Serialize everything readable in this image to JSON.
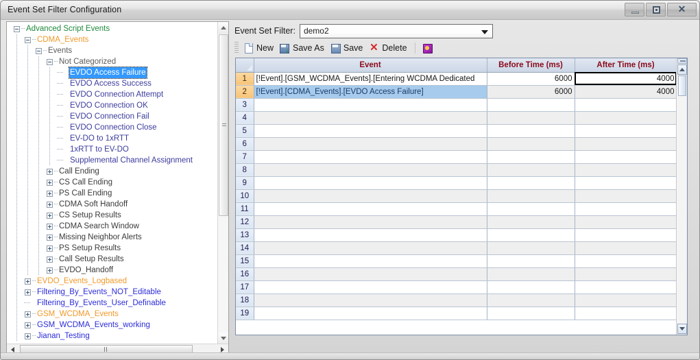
{
  "window": {
    "title": "Event Set Filter Configuration",
    "controls": {
      "minimize": "–",
      "restore": "❐",
      "close": "✕"
    }
  },
  "tree": {
    "nodes": [
      {
        "label": "Advanced Script Events",
        "depth": 0,
        "color": "green",
        "state": "expanded",
        "selected": false
      },
      {
        "label": "CDMA_Events",
        "depth": 1,
        "color": "orange",
        "state": "expanded",
        "selected": false
      },
      {
        "label": "Events",
        "depth": 2,
        "color": "gray",
        "state": "expanded",
        "selected": false
      },
      {
        "label": "Not Categorized",
        "depth": 3,
        "color": "gray",
        "state": "expanded",
        "selected": false
      },
      {
        "label": "EVDO Access Failure",
        "depth": 4,
        "color": "navy",
        "state": "leaf",
        "selected": true
      },
      {
        "label": "EVDO Access Success",
        "depth": 4,
        "color": "navy",
        "state": "leaf",
        "selected": false
      },
      {
        "label": "EVDO Connection Attempt",
        "depth": 4,
        "color": "navy",
        "state": "leaf",
        "selected": false
      },
      {
        "label": "EVDO Connection OK",
        "depth": 4,
        "color": "navy",
        "state": "leaf",
        "selected": false
      },
      {
        "label": "EVDO Connection Fail",
        "depth": 4,
        "color": "navy",
        "state": "leaf",
        "selected": false
      },
      {
        "label": "EVDO Connection Close",
        "depth": 4,
        "color": "navy",
        "state": "leaf",
        "selected": false
      },
      {
        "label": "EV-DO to 1xRTT",
        "depth": 4,
        "color": "navy",
        "state": "leaf",
        "selected": false
      },
      {
        "label": "1xRTT to EV-DO",
        "depth": 4,
        "color": "navy",
        "state": "leaf",
        "selected": false
      },
      {
        "label": "Supplemental Channel Assignment",
        "depth": 4,
        "color": "navy",
        "state": "leaf",
        "selected": false
      },
      {
        "label": "Call Ending",
        "depth": 3,
        "color": "dark",
        "state": "collapsed",
        "selected": false
      },
      {
        "label": "CS Call Ending",
        "depth": 3,
        "color": "dark",
        "state": "collapsed",
        "selected": false
      },
      {
        "label": "PS Call Ending",
        "depth": 3,
        "color": "dark",
        "state": "collapsed",
        "selected": false
      },
      {
        "label": "CDMA Soft Handoff",
        "depth": 3,
        "color": "dark",
        "state": "collapsed",
        "selected": false
      },
      {
        "label": "CS Setup Results",
        "depth": 3,
        "color": "dark",
        "state": "collapsed",
        "selected": false
      },
      {
        "label": "CDMA Search Window",
        "depth": 3,
        "color": "dark",
        "state": "collapsed",
        "selected": false
      },
      {
        "label": "Missing Neighbor Alerts",
        "depth": 3,
        "color": "dark",
        "state": "collapsed",
        "selected": false
      },
      {
        "label": "PS Setup Results",
        "depth": 3,
        "color": "dark",
        "state": "collapsed",
        "selected": false
      },
      {
        "label": "Call Setup Results",
        "depth": 3,
        "color": "dark",
        "state": "collapsed",
        "selected": false
      },
      {
        "label": "EVDO_Handoff",
        "depth": 3,
        "color": "dark",
        "state": "collapsed",
        "selected": false
      },
      {
        "label": "EVDO_Events_Logbased",
        "depth": 1,
        "color": "orange",
        "state": "collapsed",
        "selected": false
      },
      {
        "label": "Filtering_By_Events_NOT_Editable",
        "depth": 1,
        "color": "blue",
        "state": "collapsed",
        "selected": false
      },
      {
        "label": "Filtering_By_Events_User_Definable",
        "depth": 1,
        "color": "blue",
        "state": "leaf",
        "selected": false
      },
      {
        "label": "GSM_WCDMA_Events",
        "depth": 1,
        "color": "orange",
        "state": "collapsed",
        "selected": false
      },
      {
        "label": "GSM_WCDMA_Events_working",
        "depth": 1,
        "color": "blue",
        "state": "collapsed",
        "selected": false
      },
      {
        "label": "Jianan_Testing",
        "depth": 1,
        "color": "blue",
        "state": "collapsed",
        "selected": false
      }
    ]
  },
  "filter": {
    "label": "Event Set Filter:",
    "value": "demo2"
  },
  "toolbar": {
    "new_label": "New",
    "saveas_label": "Save As",
    "save_label": "Save",
    "delete_label": "Delete",
    "saveas_badge": "↓"
  },
  "grid": {
    "columns": [
      "",
      "Event",
      "Before Time (ms)",
      "After Time (ms)"
    ],
    "rows": [
      {
        "num": "1",
        "event": "[!Event].[GSM_WCDMA_Events].[Entering WCDMA Dedicated",
        "before": "6000",
        "after": "4000"
      },
      {
        "num": "2",
        "event": "[!Event].[CDMA_Events].[EVDO Access Failure]",
        "before": "6000",
        "after": "4000"
      },
      {
        "num": "3",
        "event": "",
        "before": "",
        "after": ""
      },
      {
        "num": "4",
        "event": "",
        "before": "",
        "after": ""
      },
      {
        "num": "5",
        "event": "",
        "before": "",
        "after": ""
      },
      {
        "num": "6",
        "event": "",
        "before": "",
        "after": ""
      },
      {
        "num": "7",
        "event": "",
        "before": "",
        "after": ""
      },
      {
        "num": "8",
        "event": "",
        "before": "",
        "after": ""
      },
      {
        "num": "9",
        "event": "",
        "before": "",
        "after": ""
      },
      {
        "num": "10",
        "event": "",
        "before": "",
        "after": ""
      },
      {
        "num": "11",
        "event": "",
        "before": "",
        "after": ""
      },
      {
        "num": "12",
        "event": "",
        "before": "",
        "after": ""
      },
      {
        "num": "13",
        "event": "",
        "before": "",
        "after": ""
      },
      {
        "num": "14",
        "event": "",
        "before": "",
        "after": ""
      },
      {
        "num": "15",
        "event": "",
        "before": "",
        "after": ""
      },
      {
        "num": "16",
        "event": "",
        "before": "",
        "after": ""
      },
      {
        "num": "17",
        "event": "",
        "before": "",
        "after": ""
      },
      {
        "num": "18",
        "event": "",
        "before": "",
        "after": ""
      },
      {
        "num": "19",
        "event": "",
        "before": "",
        "after": ""
      }
    ]
  },
  "colors": {
    "header_text": "#8b0a1a",
    "selection": "#3399ff",
    "row_selected": "#a6cbec",
    "rownum_active": "#f7c479",
    "tree_green": "#1f8a3b",
    "tree_orange": "#f0992b",
    "tree_navy": "#3b3b9e",
    "tree_blue": "#2b2bd8"
  }
}
